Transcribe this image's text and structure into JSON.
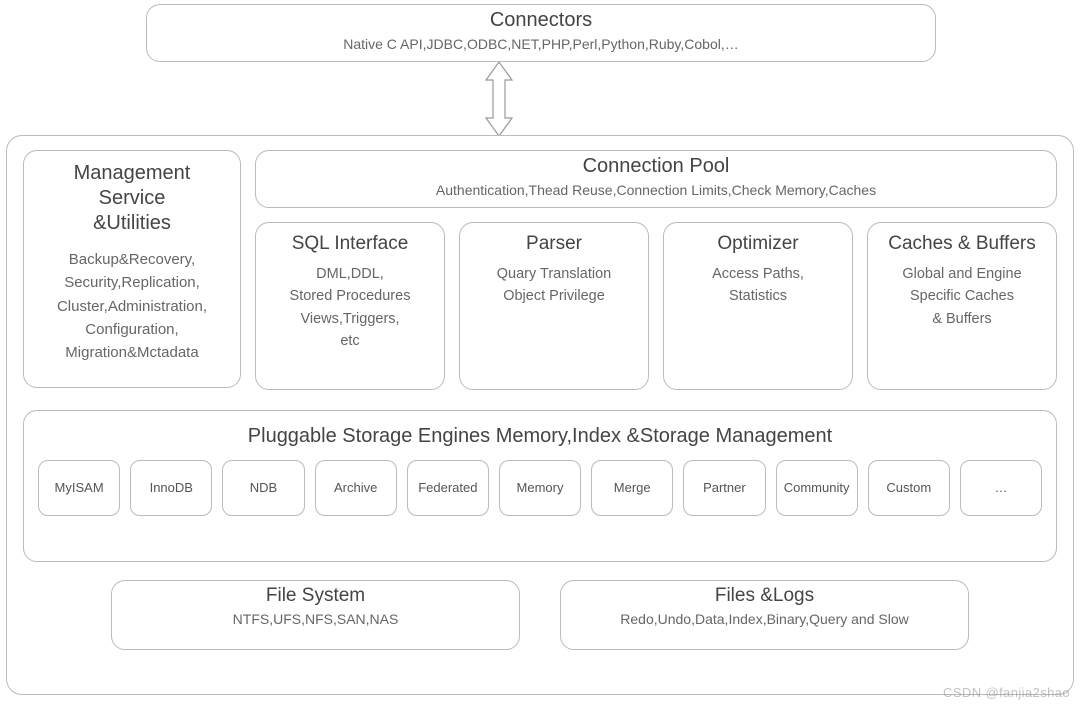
{
  "connectors": {
    "title": "Connectors",
    "subtitle": "Native C API,JDBC,ODBC,NET,PHP,Perl,Python,Ruby,Cobol,…"
  },
  "management": {
    "title": "Management\nService\n&Utilities",
    "subtitle": "Backup&Recovery,\nSecurity,Replication,\nCluster,Administration,\nConfiguration,\nMigration&Mctadata"
  },
  "connection_pool": {
    "title": "Connection Pool",
    "subtitle": "Authentication,Thead Reuse,Connection Limits,Check Memory,Caches"
  },
  "modules": [
    {
      "title": "SQL Interface",
      "subtitle": "DML,DDL,\nStored Procedures\nViews,Triggers,\netc"
    },
    {
      "title": "Parser",
      "subtitle": "Quary Translation\nObject Privilege"
    },
    {
      "title": "Optimizer",
      "subtitle": "Access Paths,\nStatistics"
    },
    {
      "title": "Caches & Buffers",
      "subtitle": "Global and Engine\nSpecific Caches\n& Buffers"
    }
  ],
  "storage": {
    "title": "Pluggable Storage Engines Memory,Index &Storage Management",
    "engines": [
      "MyISAM",
      "InnoDB",
      "NDB",
      "Archive",
      "Federated",
      "Memory",
      "Merge",
      "Partner",
      "Community",
      "Custom",
      "…"
    ]
  },
  "file_system": {
    "title": "File System",
    "subtitle": "NTFS,UFS,NFS,SAN,NAS"
  },
  "files_logs": {
    "title": "Files &Logs",
    "subtitle": "Redo,Undo,Data,Index,Binary,Query and Slow"
  },
  "watermark": "CSDN @fanjia2shao"
}
